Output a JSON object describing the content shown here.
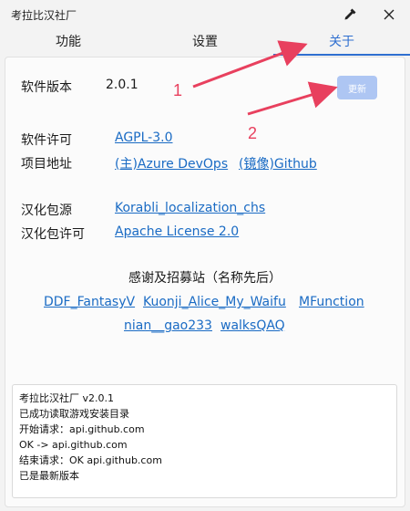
{
  "window": {
    "title": "考拉比汉社厂"
  },
  "tabs": [
    {
      "label": "功能"
    },
    {
      "label": "设置"
    },
    {
      "label": "关于",
      "active": true
    }
  ],
  "about": {
    "version_label": "软件版本",
    "version_value": "2.0.1",
    "update_button": "更新",
    "license_label": "软件许可",
    "license_link": "AGPL-3.0",
    "repo_label": "项目地址",
    "repo_main": "(主)Azure DevOps",
    "repo_mirror": "(镜像)Github",
    "loc_source_label": "汉化包源",
    "loc_source_link": "Korabli_localization_chs",
    "loc_license_label": "汉化包许可",
    "loc_license_link": "Apache License 2.0",
    "thanks_title": "感谢及招募站（名称先后）",
    "thanks": [
      "DDF_FantasyV",
      "Kuonji_Alice_My_Waifu",
      "MFunction",
      "nian__gao233",
      "walksQAQ"
    ]
  },
  "log": [
    "考拉比汉社厂 v2.0.1",
    "已成功读取游戏安装目录",
    "开始请求：api.github.com",
    "OK -> api.github.com",
    "结束请求：OK api.github.com",
    "已是最新版本"
  ],
  "annotations": {
    "marker1": "1",
    "marker2": "2",
    "color": "#e8405e"
  },
  "colors": {
    "accent": "#2f6fd0",
    "link": "#1a6bc4",
    "button_disabled": "#aec6f3"
  },
  "icons": {
    "pick": "eyedropper-icon",
    "close": "close-icon"
  }
}
